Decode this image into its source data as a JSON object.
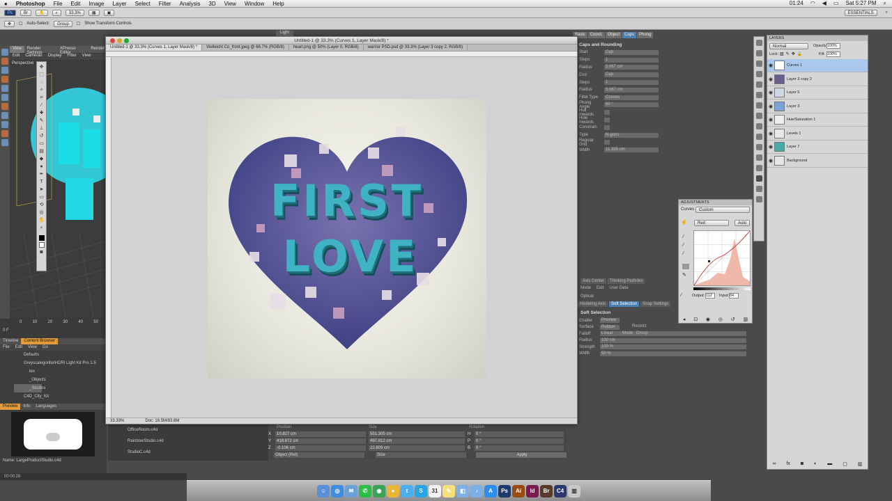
{
  "menubar": {
    "app": "Photoshop",
    "items": [
      "File",
      "Edit",
      "Image",
      "Layer",
      "Select",
      "Filter",
      "Analysis",
      "3D",
      "View",
      "Window",
      "Help"
    ],
    "clock": "01:24",
    "datetime": "Sat 5:27 PM"
  },
  "psbar": {
    "zoom": "33.3%",
    "workspace": "ESSENTIALS"
  },
  "options": {
    "auto_select": "Auto-Select:",
    "group": "Group",
    "transform": "Show Transform Controls"
  },
  "c4d": {
    "tabs": [
      "View",
      "Render Settings",
      "XPresso Editor",
      "Render"
    ],
    "viewport_menu": [
      "Edit",
      "Cameras",
      "Display",
      "Filter",
      "View"
    ],
    "viewport_label": "Perspective",
    "timeline_ticks": [
      "0",
      "10",
      "20",
      "30",
      "40",
      "50",
      "60",
      "70",
      "80",
      "90"
    ],
    "frame": "0 F",
    "browser_tabs": [
      "Timeline",
      "Content Browser"
    ],
    "browser_menu": [
      "File",
      "Edit",
      "View",
      "Go"
    ],
    "tree": [
      "Defaults",
      "Greyscalegorilla\\HDRI Light Kit Pro 1.5",
      "tex",
      "_Objects",
      "_Studios",
      "C4D_City_Kit"
    ],
    "preview_tabs": [
      "Preview",
      "Info",
      "Languages"
    ],
    "name_label": "Name:",
    "name_value": "LargeProductStudio.c4d",
    "status": "00:00:28",
    "objects": [
      "OfficeRoom.c4d",
      "RainbowStudio.c4d",
      "StudioC.c4d"
    ]
  },
  "document": {
    "title": "Untitled-1 @ 33.3% (Curves 1, Layer Mask/8) *",
    "tabs": [
      "Untitled-1 @ 33.3% (Curves 1, Layer Mask/8) *",
      "Vielleicht Co_front.jpeg @ 66.7% (RGB/8)",
      "heart.png @ 50% (Layer 0, RGB/8)",
      "warrior PSD.psd @ 33.3% (Layer 3 copy 2, RGB/8)"
    ],
    "zoom": "33.33%",
    "doc_size": "Doc: 16.5M/83.8M",
    "light_label": "Light",
    "art_line1": "FIRST",
    "art_line2": "LOVE"
  },
  "attributes": {
    "tabs": [
      "Basic",
      "Coord.",
      "Object",
      "Caps",
      "Phong"
    ],
    "section": "Caps and Rounding",
    "rows": [
      {
        "label": "Start",
        "value": "Cap"
      },
      {
        "label": "Steps",
        "value": "1"
      },
      {
        "label": "Radius",
        "value": "5.067 cm"
      },
      {
        "label": "End",
        "value": "Cap"
      },
      {
        "label": "Steps",
        "value": "1"
      },
      {
        "label": "Radius",
        "value": "5.067 cm"
      },
      {
        "label": "Fillet Type",
        "value": "Convex"
      },
      {
        "label": "Phong Angle",
        "value": "60 °"
      },
      {
        "label": "Hull Inwards",
        "value": ""
      },
      {
        "label": "Hole Inwards",
        "value": ""
      },
      {
        "label": "Constrain",
        "value": ""
      },
      {
        "label": "Type",
        "value": "N-gons"
      },
      {
        "label": "Regular Grid",
        "value": ""
      },
      {
        "label": "Width",
        "value": "11.335 cm"
      }
    ],
    "lower_tabs": [
      "Axis Center",
      "Thinking Particles"
    ],
    "lower_menu": [
      "Mode",
      "Edit",
      "User Data"
    ],
    "lower_title": "Optical",
    "lower_subtabs": [
      "Modeling Axis",
      "Soft Selection",
      "Snap Settings"
    ],
    "soft_title": "Soft Selection",
    "soft_rows": [
      {
        "label": "Enable",
        "value": "Preview"
      },
      {
        "label": "Surface",
        "value": "Rubber"
      },
      {
        "label": "Falloff",
        "value": "Linear"
      },
      {
        "label": "Radius",
        "value": "100 cm"
      },
      {
        "label": "Strength",
        "value": "100 %"
      },
      {
        "label": "Width",
        "value": "50 %"
      }
    ],
    "restrict": "Restrict",
    "mode": "Mode",
    "mode_value": "Group"
  },
  "adjustments": {
    "title": "ADJUSTMENTS",
    "curves_label": "Curves",
    "preset": "Custom",
    "channel": "Red",
    "auto": "Auto",
    "output_label": "Output:",
    "output_value": "112",
    "input_label": "Input:",
    "input_value": "84"
  },
  "layers": {
    "title": "LAYERS",
    "blend": "Normal",
    "opacity_label": "Opacity:",
    "opacity": "100%",
    "lock_label": "Lock:",
    "fill_label": "Fill:",
    "fill": "100%",
    "items": [
      {
        "name": "Curves 1",
        "selected": true
      },
      {
        "name": "Layer 3 copy 2",
        "selected": false
      },
      {
        "name": "Layer 5",
        "selected": false
      },
      {
        "name": "Layer 3",
        "selected": false
      },
      {
        "name": "Hue/Saturation 1",
        "selected": false
      },
      {
        "name": "Levels 1",
        "selected": false
      },
      {
        "name": "Layer 7",
        "selected": false
      },
      {
        "name": "Background",
        "selected": false
      }
    ]
  },
  "coords": {
    "headers": [
      "Position",
      "Size",
      "Rotation"
    ],
    "rows": [
      {
        "axis": "X",
        "pos": "10.827 cm",
        "size": "551.305 cm",
        "rot_axis": "H",
        "rot": "0 °"
      },
      {
        "axis": "Y",
        "pos": "418.872 cm",
        "size": "497.812 cm",
        "rot_axis": "P",
        "rot": "0 °"
      },
      {
        "axis": "Z",
        "pos": "-0.106 cm",
        "size": "22.609 cm",
        "rot_axis": "B",
        "rot": "0 °"
      }
    ],
    "object_mode": "Object (Rel)",
    "size_mode": "Size",
    "apply": "Apply"
  },
  "dock": [
    "Finder",
    "Safari",
    "Mail",
    "Messages",
    "FaceTime",
    "Chrome",
    "Twitter",
    "Skype",
    "Calendar",
    "Notes",
    "Preview",
    "iTunes",
    "App Store",
    "Photoshop",
    "Illustrator",
    "InDesign",
    "Bridge",
    "Cinema 4D",
    "Trash"
  ],
  "colors": {
    "accent": "#4d7fb2",
    "layer_selected": "#a9c8ec",
    "teal": "#3fb3c4",
    "heart": "#4e4e90"
  }
}
